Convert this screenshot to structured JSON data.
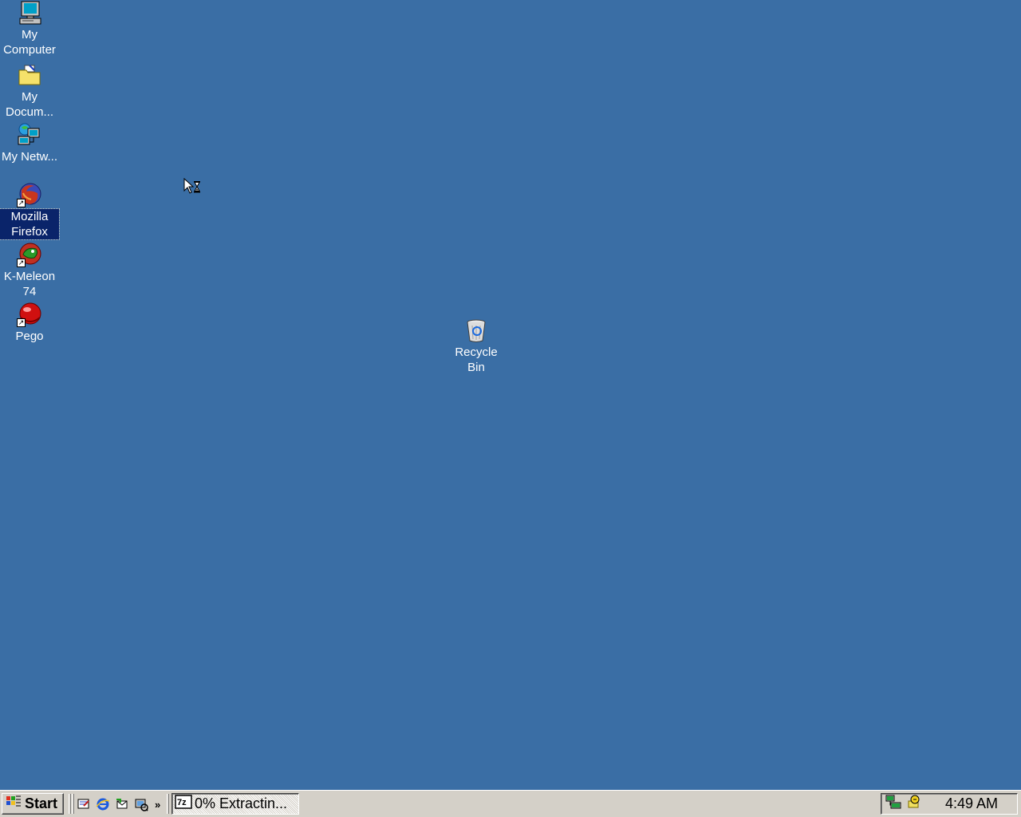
{
  "desktop": {
    "background_color": "#3a6ea5",
    "selection_color": "#0a246a",
    "icons": [
      {
        "name": "my-computer",
        "label": "My Computer",
        "icon": "computer-icon",
        "selected": false,
        "shortcut": false
      },
      {
        "name": "my-documents",
        "label": "My Docum...",
        "icon": "documents-folder-icon",
        "selected": false,
        "shortcut": false
      },
      {
        "name": "my-network",
        "label": "My Netw...",
        "icon": "network-places-icon",
        "selected": false,
        "shortcut": false
      },
      {
        "name": "mozilla-firefox",
        "label": "Mozilla Firefox",
        "icon": "firefox-icon",
        "selected": true,
        "shortcut": true
      },
      {
        "name": "k-meleon",
        "label": "K-Meleon 74",
        "icon": "k-meleon-icon",
        "selected": false,
        "shortcut": true
      },
      {
        "name": "pego",
        "label": "Pego",
        "icon": "pego-icon",
        "selected": false,
        "shortcut": true
      },
      {
        "name": "recycle-bin",
        "label": "Recycle Bin",
        "icon": "recycle-bin-icon",
        "selected": false,
        "shortcut": false
      }
    ],
    "cursor": "busy-arrow-cursor"
  },
  "taskbar": {
    "background_color": "#d4d0c8",
    "start_label": "Start",
    "quick_launch": [
      {
        "icon": "show-desktop-icon"
      },
      {
        "icon": "internet-explorer-icon"
      },
      {
        "icon": "outlook-express-icon"
      },
      {
        "icon": "media-player-icon"
      }
    ],
    "quick_launch_more": "»",
    "tasks": [
      {
        "label": "0% Extractin...",
        "icon": "7zip-icon",
        "active": false
      }
    ],
    "tray_icons": [
      {
        "icon": "network-tray-icon"
      },
      {
        "icon": "security-tray-icon"
      }
    ],
    "clock": "4:49 AM"
  }
}
